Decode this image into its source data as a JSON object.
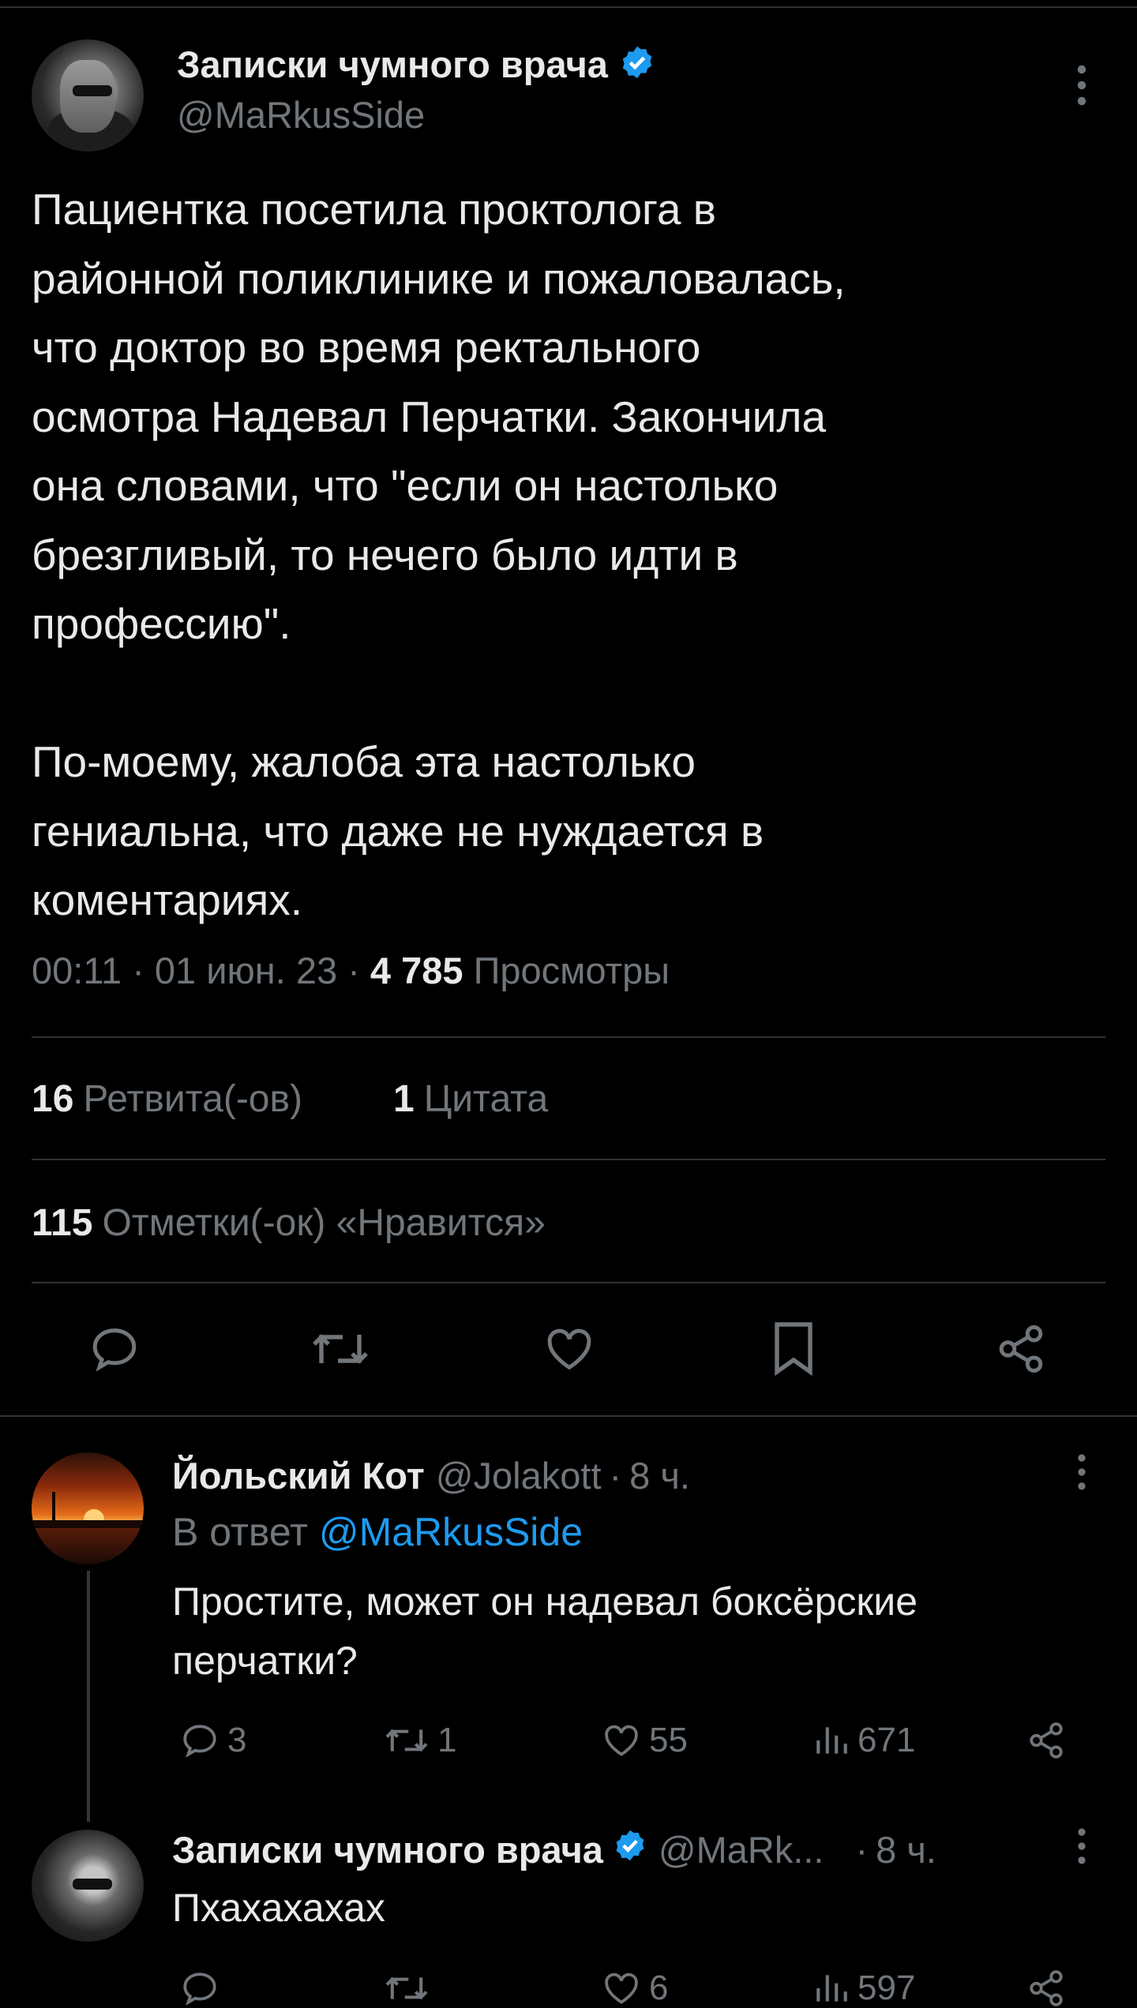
{
  "tweet": {
    "author_name": "Записки чумного врача",
    "author_handle": "@MaRkusSide",
    "text_paragraph_1_lines": [
      "Пациентка посетила проктолога в",
      "районной поликлинике и пожаловалась,",
      "что доктор во время ректального",
      "осмотра Надевал Перчатки. Закончила",
      "она словами, что \"если он настолько",
      "брезгливый, то нечего было идти в",
      "профессию\"."
    ],
    "text_paragraph_2_lines": [
      "По-моему, жалоба эта настолько",
      "гениальна, что даже не нуждается в",
      "коментариях."
    ],
    "time": "00:11",
    "date": "01 июн. 23",
    "views_count": "4 785",
    "views_label": "Просмотры",
    "retweets_count": "16",
    "retweets_label": "Ретвита(-ов)",
    "quotes_count": "1",
    "quotes_label": "Цитата",
    "likes_count": "115",
    "likes_label": "Отметки(-ок) «Нравится»",
    "separator": "·"
  },
  "replies": [
    {
      "author_name": "Йольский Кот",
      "author_handle": "@Jolakott",
      "time_ago": "8 ч.",
      "replying_prefix": "В ответ",
      "replying_to": "@MaRkusSide",
      "text_lines": [
        "Простите, может он надевал боксёрские",
        "перчатки?"
      ],
      "replies_count": "3",
      "retweets_count": "1",
      "likes_count": "55",
      "views_count": "671"
    },
    {
      "author_name": "Записки чумного врача",
      "author_handle": "@MaRk...",
      "time_ago": "8 ч.",
      "text": "Пхахахахах",
      "likes_count": "6",
      "views_count": "597"
    }
  ],
  "icons": {
    "verified": "verified-badge-icon",
    "more": "more-vertical-icon",
    "reply": "reply-bubble-icon",
    "retweet": "retweet-icon",
    "like": "heart-icon",
    "bookmark": "bookmark-icon",
    "share": "share-icon",
    "views": "views-bar-icon"
  },
  "colors": {
    "background": "#000000",
    "text": "#e7e9ea",
    "muted": "#71767b",
    "accent": "#1d9bf0",
    "divider": "#2f3336"
  }
}
